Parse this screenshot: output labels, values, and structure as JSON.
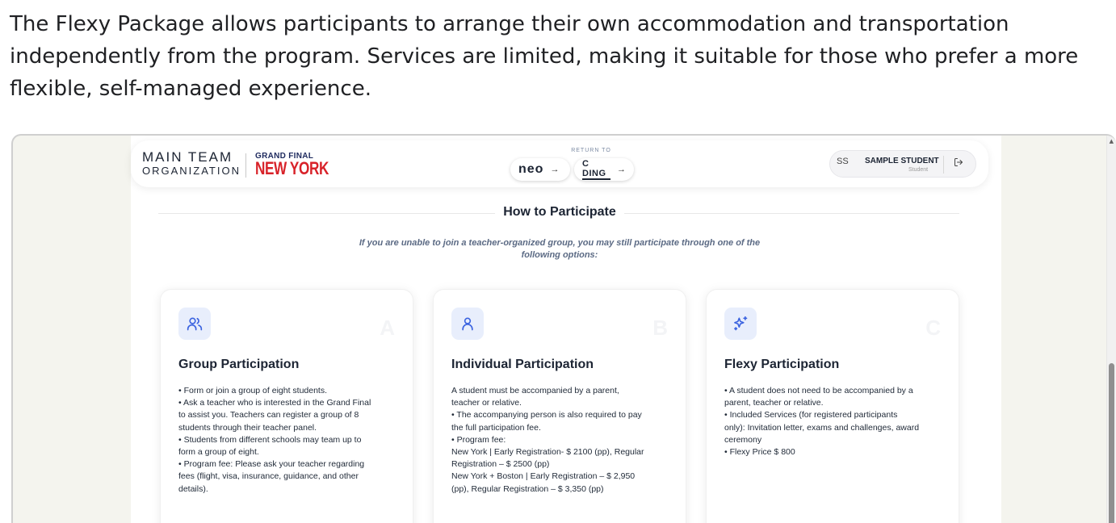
{
  "intro": {
    "text": "The Flexy Package allows participants to arrange their own accommodation and transportation independently from the program. Services are limited, making it suitable for those who prefer a more flexible, self-managed experience."
  },
  "header": {
    "logo_line1": "MAIN TEAM",
    "logo_line2": "ORGANIZATION",
    "grand_final": "GRAND FINAL",
    "city": "NEW YORK",
    "return_to": "RETURN TO",
    "return_links": [
      {
        "label": "neo",
        "arrow": "→"
      },
      {
        "label": "C DING",
        "arrow": "→"
      }
    ],
    "user": {
      "initials": "SS",
      "name": "SAMPLE STUDENT",
      "role": "Student"
    }
  },
  "section": {
    "title": "How to Participate",
    "subtitle": "If you are unable to join a teacher-organized group, you may still participate through one of the following options:"
  },
  "cards": [
    {
      "letter": "A",
      "icon": "users-icon",
      "title": "Group Participation",
      "lines": [
        "• Form or join a group of eight students.",
        "• Ask a teacher who is interested in the Grand Final",
        "to assist you. Teachers can register a group of 8",
        "students through their teacher panel.",
        "• Students from different schools may team up to",
        "form a group of eight.",
        "• Program fee: Please ask your teacher regarding",
        "fees (flight, visa, insurance, guidance, and other",
        "details)."
      ]
    },
    {
      "letter": "B",
      "icon": "user-icon",
      "title": "Individual Participation",
      "lines": [
        "A student must be accompanied by a parent,",
        "teacher or relative.",
        "• The accompanying person is also required to pay",
        "the full participation fee.",
        "• Program fee:",
        "New York  | Early Registration- $ 2100 (pp), Regular",
        "Registration – $ 2500 (pp)",
        "New York + Boston | Early Registration – $ 2,950",
        "(pp), Regular Registration – $ 3,350 (pp)"
      ]
    },
    {
      "letter": "C",
      "icon": "sparkles-icon",
      "title": "Flexy Participation",
      "lines": [
        "• A student does not need to be accompanied by a",
        "parent, teacher or relative.",
        "• Included Services (for registered participants",
        "only): Invitation letter, exams and challenges, award",
        "ceremony",
        "• Flexy Price $ 800"
      ]
    }
  ],
  "colors": {
    "accent": "#3b63e0",
    "icon_bg": "#e8eefc",
    "heading": "#1c2433",
    "city_red": "#d8232a"
  }
}
